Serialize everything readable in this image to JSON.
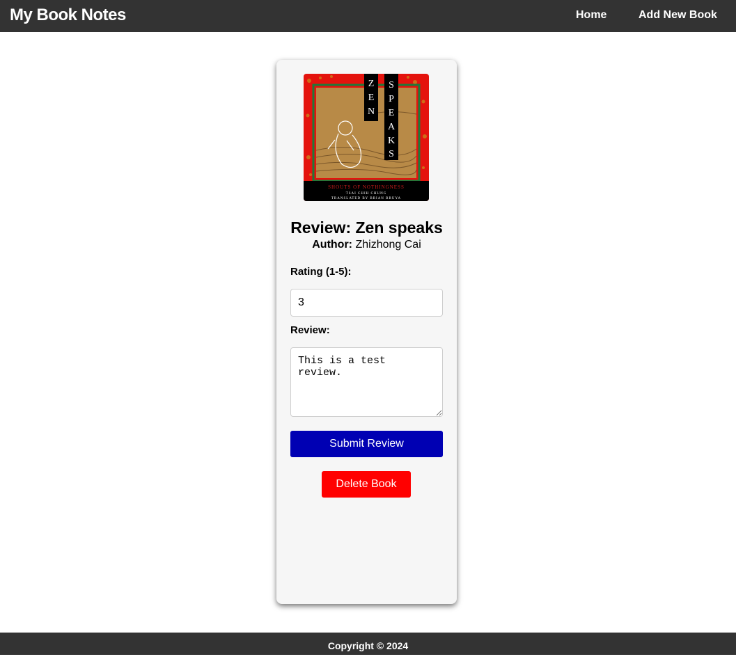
{
  "header": {
    "brand": "My Book Notes",
    "nav": [
      {
        "label": "Home"
      },
      {
        "label": "Add New Book"
      }
    ]
  },
  "book": {
    "cover": {
      "title_vertical_1": "ZEN",
      "title_vertical_2": "SPEAKS",
      "subtitle": "SHOUTS OF NOTHINGNESS",
      "author": "TSAI CHIH CHUNG",
      "translator": "TRANSLATED BY BRIAN BRUYA"
    },
    "title": "Review: Zen speaks",
    "author_label": "Author:",
    "author_name": "Zhizhong Cai"
  },
  "form": {
    "rating_label": "Rating (1-5):",
    "rating_value": "3",
    "review_label": "Review:",
    "review_value": "This is a test review.",
    "submit_label": "Submit Review",
    "delete_label": "Delete Book"
  },
  "footer": {
    "copyright": "Copyright © 2024"
  },
  "colors": {
    "header_bg": "#333333",
    "submit_bg": "#0000b3",
    "delete_bg": "#ff0000",
    "card_bg": "#f6f6f6"
  }
}
